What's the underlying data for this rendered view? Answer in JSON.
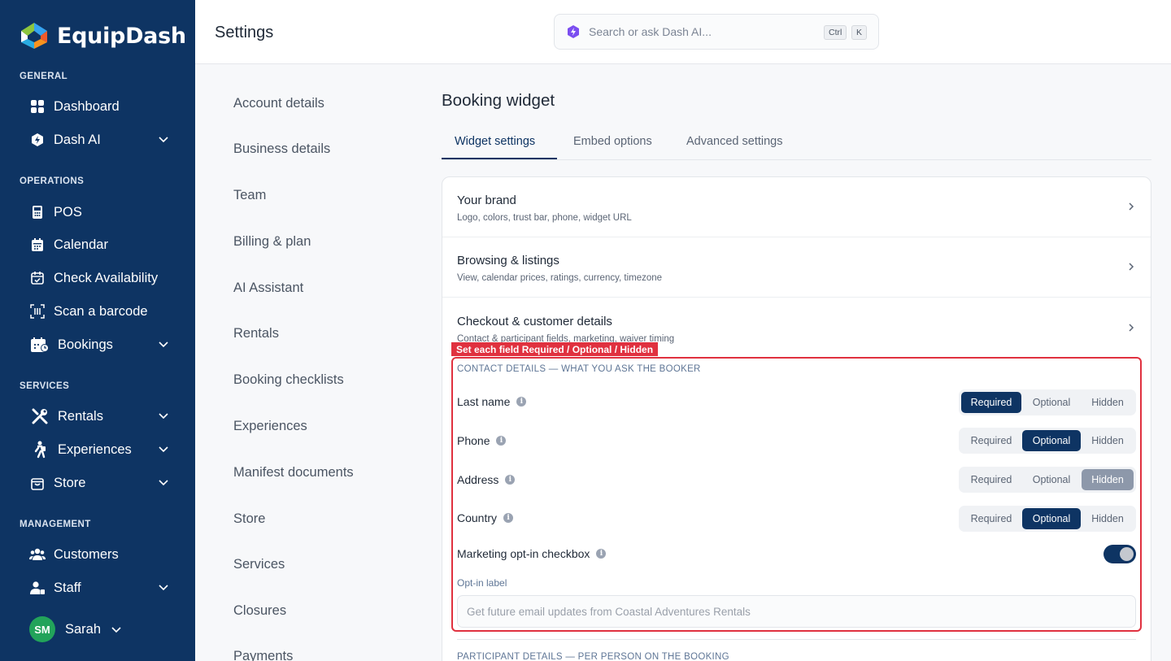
{
  "app": {
    "name": "EquipDash"
  },
  "sidebar": {
    "sections": {
      "general": "GENERAL",
      "operations": "OPERATIONS",
      "services": "SERVICES",
      "management": "MANAGEMENT"
    },
    "items": {
      "dashboard": "Dashboard",
      "dash_ai": "Dash AI",
      "pos": "POS",
      "calendar": "Calendar",
      "check_availability": "Check Availability",
      "scan_barcode": "Scan a barcode",
      "bookings": "Bookings",
      "rentals": "Rentals",
      "experiences": "Experiences",
      "store": "Store",
      "customers": "Customers",
      "staff": "Staff"
    },
    "user": {
      "initials": "SM",
      "name": "Sarah"
    }
  },
  "header": {
    "title": "Settings",
    "search_placeholder": "Search or ask Dash AI...",
    "shortcut_ctrl": "Ctrl",
    "shortcut_key": "K"
  },
  "settings_nav": [
    "Account details",
    "Business details",
    "Team",
    "Billing & plan",
    "AI Assistant",
    "Rentals",
    "Booking checklists",
    "Experiences",
    "Manifest documents",
    "Store",
    "Services",
    "Closures",
    "Payments"
  ],
  "main": {
    "title": "Booking widget",
    "tabs": [
      "Widget settings",
      "Embed options",
      "Advanced settings"
    ],
    "rows": [
      {
        "title": "Your brand",
        "subtitle": "Logo, colors, trust bar, phone, widget URL"
      },
      {
        "title": "Browsing & listings",
        "subtitle": "View, calendar prices, ratings, currency, timezone"
      },
      {
        "title": "Checkout & customer details",
        "subtitle": "Contact & participant fields, marketing, waiver timing"
      }
    ],
    "contact_section_label": "CONTACT DETAILS — WHAT YOU ASK THE BOOKER",
    "options": [
      "Required",
      "Optional",
      "Hidden"
    ],
    "fields": [
      {
        "label": "Last name",
        "value": "Required"
      },
      {
        "label": "Phone",
        "value": "Optional"
      },
      {
        "label": "Address",
        "value": "Hidden"
      },
      {
        "label": "Country",
        "value": "Optional"
      }
    ],
    "marketing_label": "Marketing opt-in checkbox",
    "marketing_enabled": true,
    "optin_label": "Opt-in label",
    "optin_placeholder": "Get future email updates from Coastal Adventures Rentals",
    "participant_section_label": "PARTICIPANT DETAILS — PER PERSON ON THE BOOKING"
  },
  "annotation": {
    "text": "Set each field Required / Optional / Hidden",
    "color": "#e0313f"
  },
  "colors": {
    "sidebar": "#0e3463",
    "accent": "#0e3463",
    "avatar": "#22a35a"
  }
}
